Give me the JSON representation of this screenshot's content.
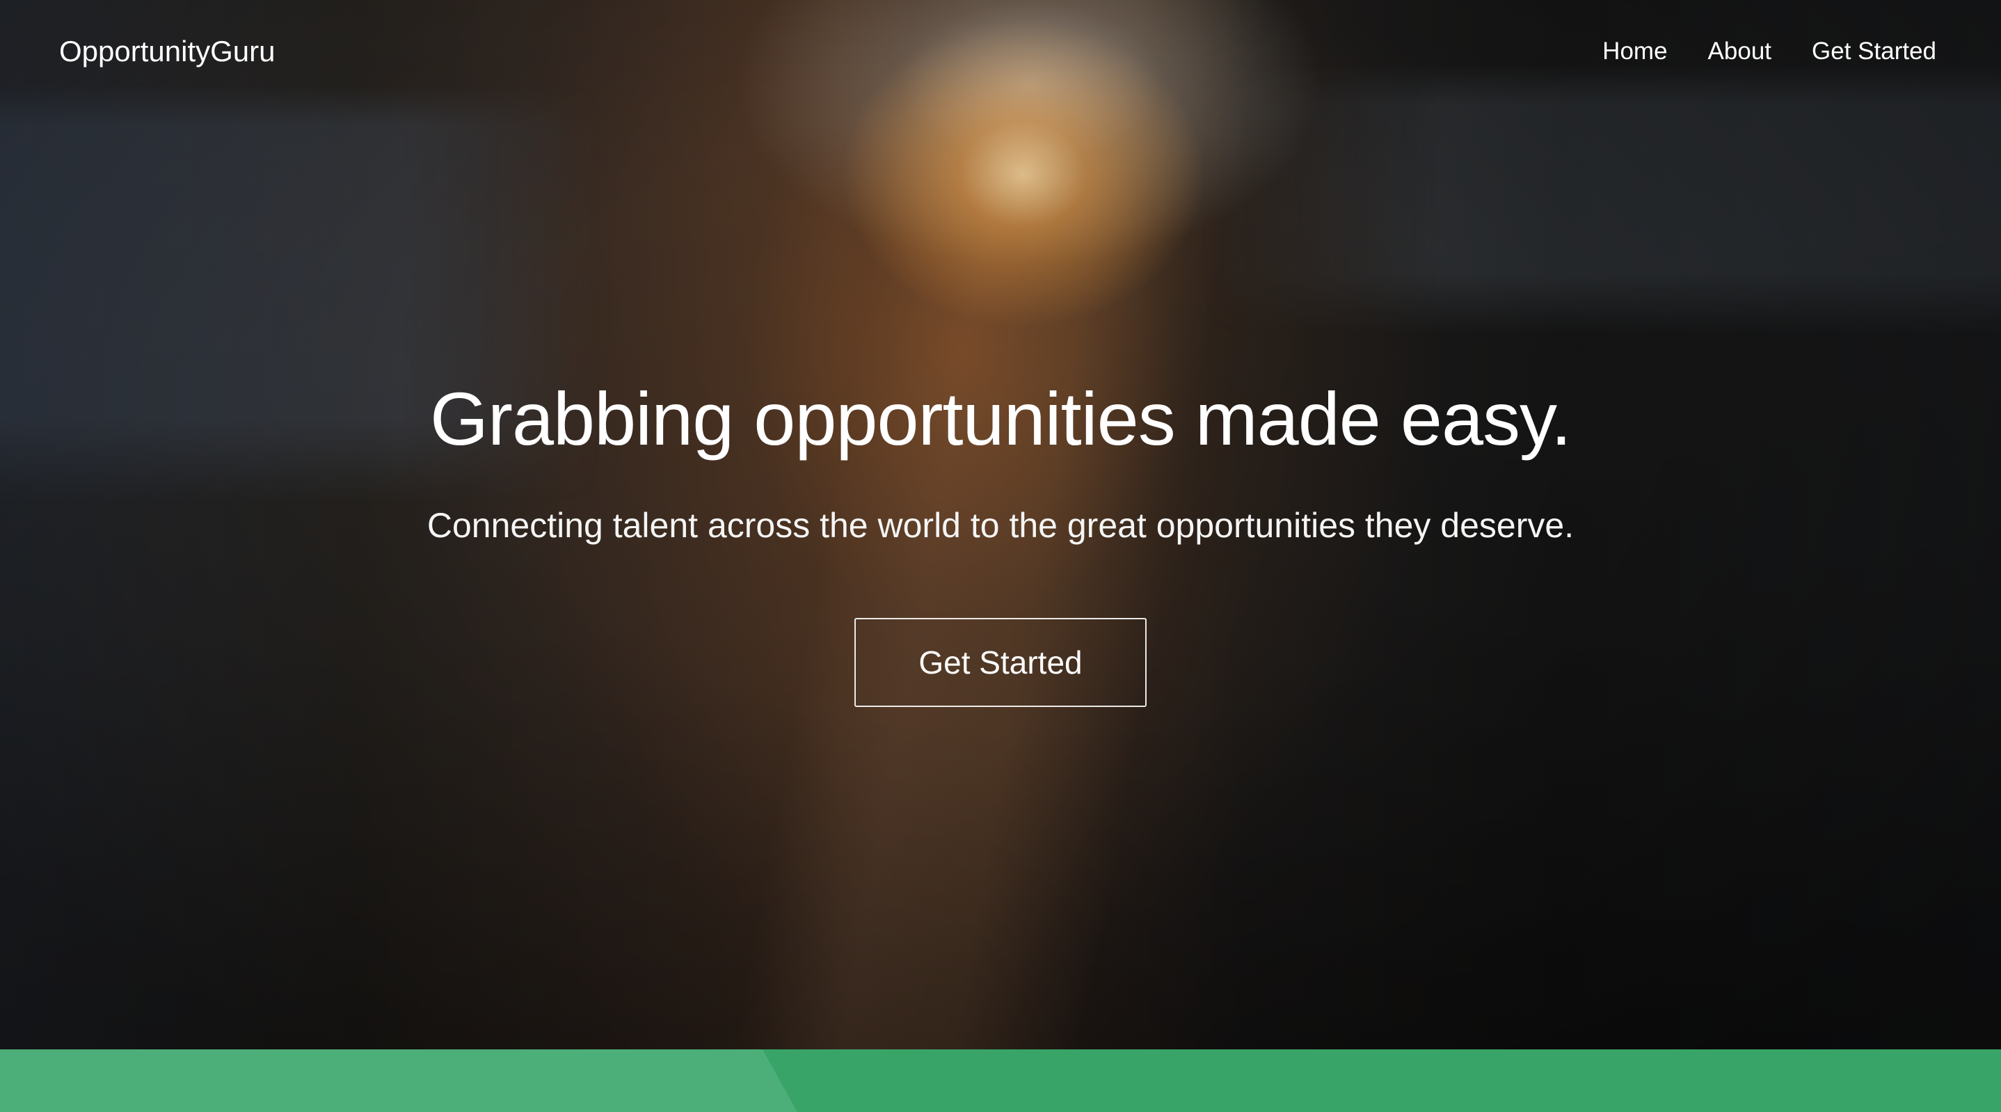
{
  "brand": {
    "name": "OpportunityGuru"
  },
  "nav": {
    "items": [
      {
        "label": "Home"
      },
      {
        "label": "About"
      },
      {
        "label": "Get Started"
      }
    ]
  },
  "hero": {
    "headline": "Grabbing opportunities made easy.",
    "subheadline": "Connecting talent across the world to the great opportunities they deserve.",
    "cta_label": "Get Started",
    "background_image": "blurred train station platform with sunset glow"
  },
  "colors": {
    "text": "#ffffff",
    "band_primary": "#39a467",
    "band_secondary": "#4cae78",
    "button_border": "#ffffff"
  }
}
